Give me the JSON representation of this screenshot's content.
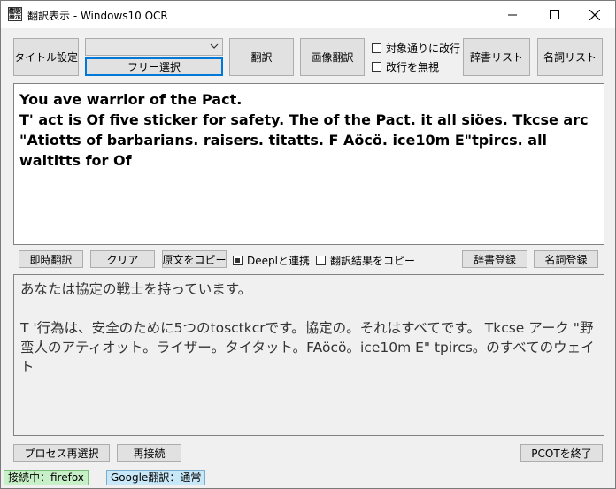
{
  "window": {
    "title": "翻訳表示 - Windows10 OCR",
    "app_icon_glyphs": [
      "翻",
      "訳",
      "表",
      "示"
    ]
  },
  "toolbar": {
    "title_settings": "タイトル設定",
    "combo_value": "",
    "free_select": "フリー選択",
    "translate": "翻訳",
    "image_translate": "画像翻訳",
    "keep_newlines": "対象通りに改行",
    "ignore_newlines": "改行を無視",
    "dictionary_list": "辞書リスト",
    "noun_list": "名詞リスト"
  },
  "source_text": "You ave warrior of the Pact.\nT' act is Of five sticker for safety. The of the Pact. it all siöes. Tkcse arc \"Atiotts of barbarians. raisers. titatts. F Aöcö. ice10m E\"tpircs. all waititts for Of",
  "middlebar": {
    "instant_translate": "即時翻訳",
    "clear": "クリア",
    "copy_original": "原文をコピー",
    "deepl_link": "Deeplと連携",
    "deepl_checked": true,
    "copy_result": "翻訳結果をコピー",
    "copy_result_checked": false,
    "register_dictionary": "辞書登録",
    "register_noun": "名詞登録"
  },
  "translated_text": "あなたは協定の戦士を持っています。\n\nT '行為は、安全のために5つのtosctkcrです。協定の。それはすべてです。 Tkcse アーク \"野蛮人のアティオット。ライザー。タイタット。FAöcö。ice10m E\" tpircs。のすべてのウェイト",
  "bottombar": {
    "reselect_process": "プロセス再選択",
    "reconnect": "再接続",
    "exit": "PCOTを終了"
  },
  "status": {
    "connection": "接続中：firefox",
    "connection_color": "#c8f0c8",
    "translator": "Google翻訳：通常",
    "translator_color": "#c8e8f8"
  }
}
